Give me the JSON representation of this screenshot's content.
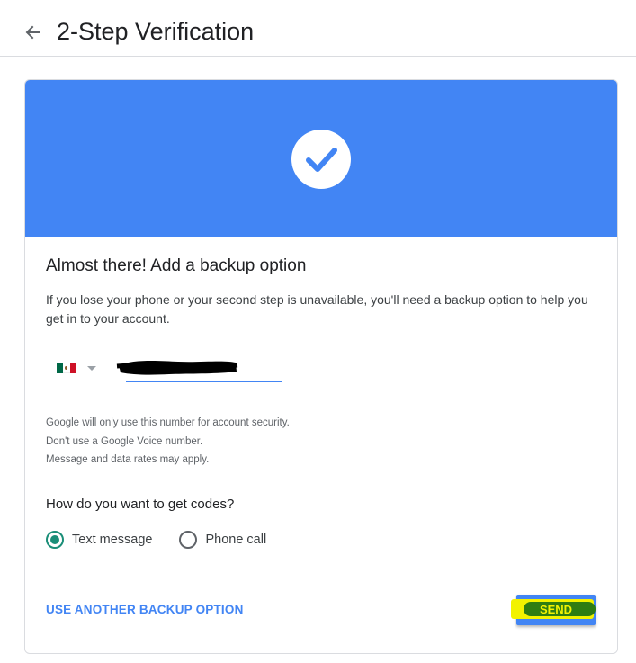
{
  "header": {
    "back_icon": "arrow-left-icon",
    "title": "2-Step Verification"
  },
  "banner": {
    "color": "#4285f4",
    "icon": "check-icon"
  },
  "card": {
    "heading": "Almost there! Add a backup option",
    "description": "If you lose your phone or your second step is unavailable, you'll need a backup option to help you get in to your account.",
    "country": {
      "flag": "mexico-flag-icon",
      "dropdown_icon": "caret-down-icon"
    },
    "phone": {
      "value": ""
    },
    "notes": [
      "Google will only use this number for account security.",
      "Don't use a Google Voice number.",
      "Message and data rates may apply."
    ],
    "codes_question": "How do you want to get codes?",
    "methods": [
      {
        "label": "Text message",
        "selected": true
      },
      {
        "label": "Phone call",
        "selected": false
      }
    ],
    "another_option_label": "USE ANOTHER BACKUP OPTION",
    "send_label": "SEND"
  },
  "colors": {
    "accent": "#4285f4",
    "radio_selected": "#1a8e78",
    "highlight": "#f2f200",
    "marker": "#2f7d12"
  }
}
